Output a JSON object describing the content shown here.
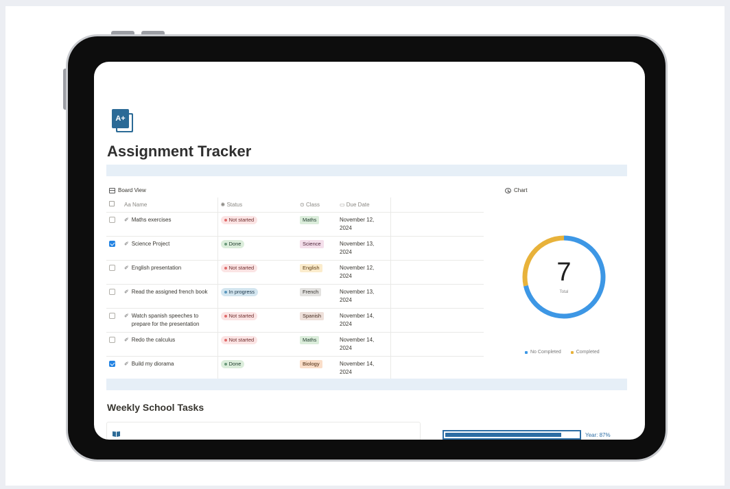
{
  "page": {
    "title": "Assignment Tracker",
    "icon": "a-plus-page-icon"
  },
  "board": {
    "view_label": "Board View",
    "columns": {
      "name": "Aa Name",
      "status": "Status",
      "class": "Class",
      "due_date": "Due Date"
    },
    "rows": [
      {
        "checked": false,
        "name": "Maths exercises",
        "status": "Not started",
        "status_color": "red",
        "class": "Maths",
        "class_tag": "maths",
        "due_line1": "November 12,",
        "due_line2": "2024"
      },
      {
        "checked": true,
        "name": "Science Project",
        "status": "Done",
        "status_color": "green",
        "class": "Science",
        "class_tag": "science",
        "due_line1": "November 13,",
        "due_line2": "2024"
      },
      {
        "checked": false,
        "name": "English presentation",
        "status": "Not started",
        "status_color": "red",
        "class": "English",
        "class_tag": "english",
        "due_line1": "November 12,",
        "due_line2": "2024"
      },
      {
        "checked": false,
        "name": "Read the assigned french book",
        "status": "In progress",
        "status_color": "blue",
        "class": "French",
        "class_tag": "french",
        "due_line1": "November 13,",
        "due_line2": "2024"
      },
      {
        "checked": false,
        "name": "Watch spanish speeches to prepare for the presentation",
        "status": "Not started",
        "status_color": "red",
        "class": "Spanish",
        "class_tag": "spanish",
        "due_line1": "November 14,",
        "due_line2": "2024"
      },
      {
        "checked": false,
        "name": "Redo the calculus",
        "status": "Not started",
        "status_color": "red",
        "class": "Maths",
        "class_tag": "maths",
        "due_line1": "November 14,",
        "due_line2": "2024"
      },
      {
        "checked": true,
        "name": "Build my diorama",
        "status": "Done",
        "status_color": "green",
        "class": "Biology",
        "class_tag": "biology",
        "due_line1": "November 14,",
        "due_line2": "2024"
      }
    ]
  },
  "chart": {
    "view_label": "Chart",
    "total": "7",
    "total_label": "Total",
    "legend": [
      {
        "label": "No Completed",
        "color": "#3d97e5"
      },
      {
        "label": "Completed",
        "color": "#e8b23a"
      }
    ]
  },
  "chart_data": {
    "type": "pie",
    "categories": [
      "No Completed",
      "Completed"
    ],
    "values": [
      5,
      2
    ],
    "colors": [
      "#3d97e5",
      "#e8b23a"
    ]
  },
  "weekly": {
    "title": "Weekly School Tasks",
    "progress_label": "Year: 87%",
    "progress_value": 0.87
  }
}
